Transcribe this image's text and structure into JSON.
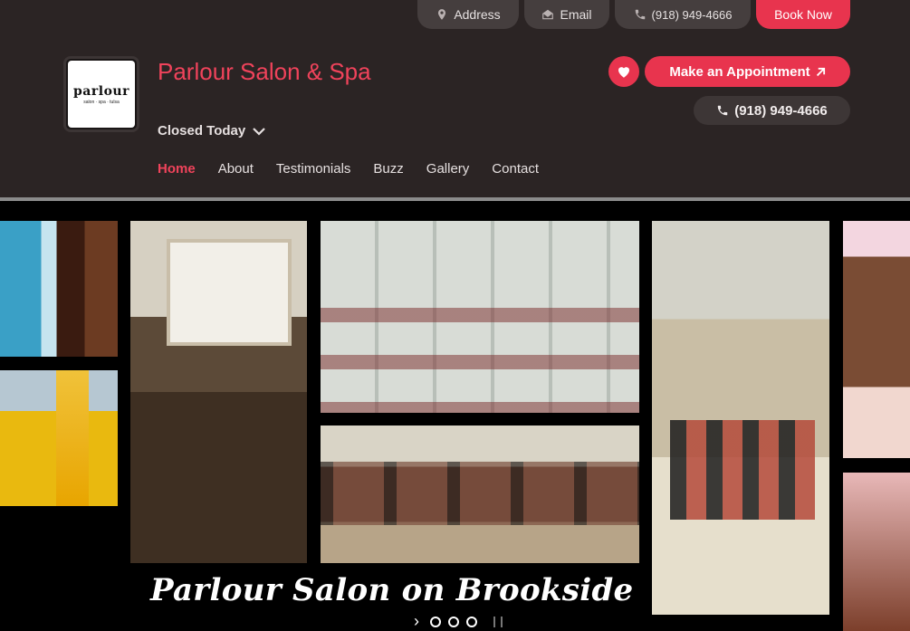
{
  "topbar": {
    "address_label": "Address",
    "email_label": "Email",
    "phone_label": "(918) 949-4666",
    "book_label": "Book Now"
  },
  "header": {
    "logo_word": "parlour",
    "logo_tagline": "salon · spa · tulsa",
    "title": "Parlour Salon & Spa",
    "hours_status": "Closed Today",
    "appointment_label": "Make an Appointment",
    "phone_label": "(918) 949-4666"
  },
  "nav": {
    "items": [
      {
        "label": "Home",
        "active": true
      },
      {
        "label": "About"
      },
      {
        "label": "Testimonials"
      },
      {
        "label": "Buzz"
      },
      {
        "label": "Gallery"
      },
      {
        "label": "Contact"
      }
    ]
  },
  "gallery": {
    "caption": "Parlour Salon on Brookside",
    "slide_count": 3,
    "active_slide": 0
  },
  "colors": {
    "accent": "#e8344e",
    "header_bg": "#2b2424",
    "pill_bg": "#453e3e"
  },
  "icons": [
    "map-pin-icon",
    "envelope-icon",
    "phone-icon",
    "chevron-down-icon",
    "heart-icon",
    "external-arrow-icon",
    "next-icon",
    "pause-icon"
  ]
}
